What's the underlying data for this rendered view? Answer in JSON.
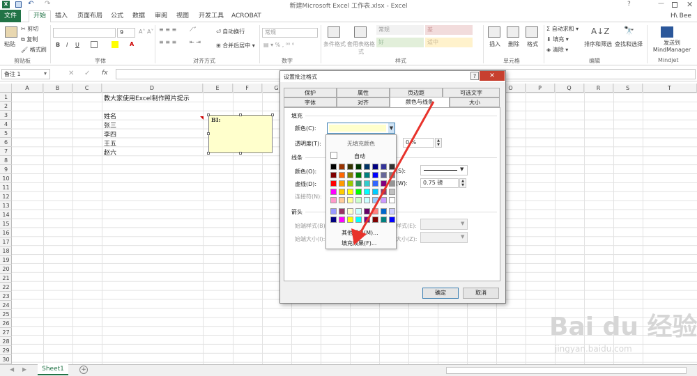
{
  "window_title": "新建Microsoft Excel 工作表.xlsx - Excel",
  "user_initials": "H\\ Bee",
  "ribbon_tabs": [
    "文件",
    "开始",
    "插入",
    "页面布局",
    "公式",
    "数据",
    "审阅",
    "视图",
    "开发工具",
    "ACROBAT"
  ],
  "clipboard": {
    "paste": "粘贴",
    "cut": "剪切",
    "copy": "复制",
    "format_painter": "格式刷",
    "label": "剪贴板"
  },
  "font_group": {
    "label": "字体",
    "size": "9",
    "bold": "B",
    "italic": "I",
    "underline": "U"
  },
  "align_group": {
    "wrap": "自动换行",
    "merge": "合并后居中",
    "label": "对齐方式"
  },
  "number_group": {
    "format": "常规",
    "label": "数字"
  },
  "styles_group": {
    "cond": "条件格式",
    "table": "套用表格格式",
    "normal": "常规",
    "bad": "差",
    "good": "好",
    "neutral": "适中",
    "label": "样式"
  },
  "cells_group": {
    "insert": "插入",
    "delete": "删除",
    "format": "格式",
    "label": "单元格"
  },
  "edit_group": {
    "autosum": "自动求和",
    "fill": "填充",
    "clear": "清除",
    "sort": "排序和筛选",
    "find": "查找和选择",
    "label": "编辑"
  },
  "mindjet": {
    "send": "发送到MindManager",
    "label": "Mindjet"
  },
  "name_box": "备注 1",
  "fx": "fx",
  "columns": [
    "A",
    "B",
    "C",
    "D",
    "E",
    "F",
    "G",
    "H",
    "I",
    "J",
    "K",
    "L",
    "M",
    "N",
    "O",
    "P",
    "Q",
    "R",
    "S",
    "T"
  ],
  "rows": [
    "1",
    "2",
    "3",
    "4",
    "5",
    "6",
    "7",
    "8",
    "9",
    "10",
    "11",
    "12",
    "13",
    "14",
    "15",
    "16",
    "17",
    "18",
    "19",
    "20",
    "21",
    "22",
    "23",
    "24",
    "25",
    "26",
    "27",
    "28",
    "29",
    "30"
  ],
  "cells": {
    "d1": "教大家使用Excel制作照片提示",
    "d3": "姓名",
    "d4": "张三",
    "d5": "李四",
    "d6": "王五",
    "d7": "赵六"
  },
  "comment_author": "BI:",
  "sheet_tab": "Sheet1",
  "watermark": {
    "brand": "Bai du 经验",
    "url": "jingyan.baidu.com"
  },
  "dialog": {
    "title": "设置批注格式",
    "help": "?",
    "tabs_row1": [
      "保护",
      "属性",
      "页边距",
      "可选文字"
    ],
    "tabs_row2": [
      "字体",
      "对齐",
      "颜色与线条",
      "大小"
    ],
    "fill_section": "填充",
    "color_label": "颜色(C):",
    "transparency_label": "透明度(T):",
    "transparency_value": "0 %",
    "line_section": "线条",
    "line_color_label": "颜色(O):",
    "dash_label": "虚线(D):",
    "connector_label": "连接符(N):",
    "style_label": "(S):",
    "weight_label": "(W):",
    "weight_value": "0.75 磅",
    "arrows_section": "箭头",
    "begin_style": "始端样式(B):",
    "begin_size": "始端大小(I):",
    "end_style": "样式(E):",
    "end_size": "大小(Z):",
    "ok": "确定",
    "cancel": "取消",
    "dropdown": {
      "no_fill": "无填充颜色",
      "auto": "自动",
      "more_colors": "其他颜色(M)...",
      "fill_effects": "填充效果(F)...",
      "palette": [
        [
          "#000000",
          "#993300",
          "#333300",
          "#003300",
          "#003366",
          "#000080",
          "#333399",
          "#333333"
        ],
        [
          "#800000",
          "#FF6600",
          "#808000",
          "#008000",
          "#008080",
          "#0000FF",
          "#666699",
          "#808080"
        ],
        [
          "#FF0000",
          "#FF9900",
          "#99CC00",
          "#339966",
          "#33CCCC",
          "#3366FF",
          "#800080",
          "#969696"
        ],
        [
          "#FF00FF",
          "#FFCC00",
          "#FFFF00",
          "#00FF00",
          "#00FFFF",
          "#00CCFF",
          "#993366",
          "#C0C0C0"
        ],
        [
          "#FF99CC",
          "#FFCC99",
          "#FFFF99",
          "#CCFFCC",
          "#CCFFFF",
          "#99CCFF",
          "#CC99FF",
          "#FFFFFF"
        ]
      ],
      "palette2": [
        [
          "#9999FF",
          "#993366",
          "#FFFFCC",
          "#CCFFFF",
          "#660066",
          "#FF8080",
          "#0066CC",
          "#CCCCFF"
        ],
        [
          "#000080",
          "#FF00FF",
          "#FFFF00",
          "#00FFFF",
          "#800080",
          "#800000",
          "#008080",
          "#0000FF"
        ]
      ]
    }
  },
  "colors": {
    "excel_green": "#217346",
    "comment_fill": "#FFFFCC",
    "arrow": "#E8322B"
  }
}
